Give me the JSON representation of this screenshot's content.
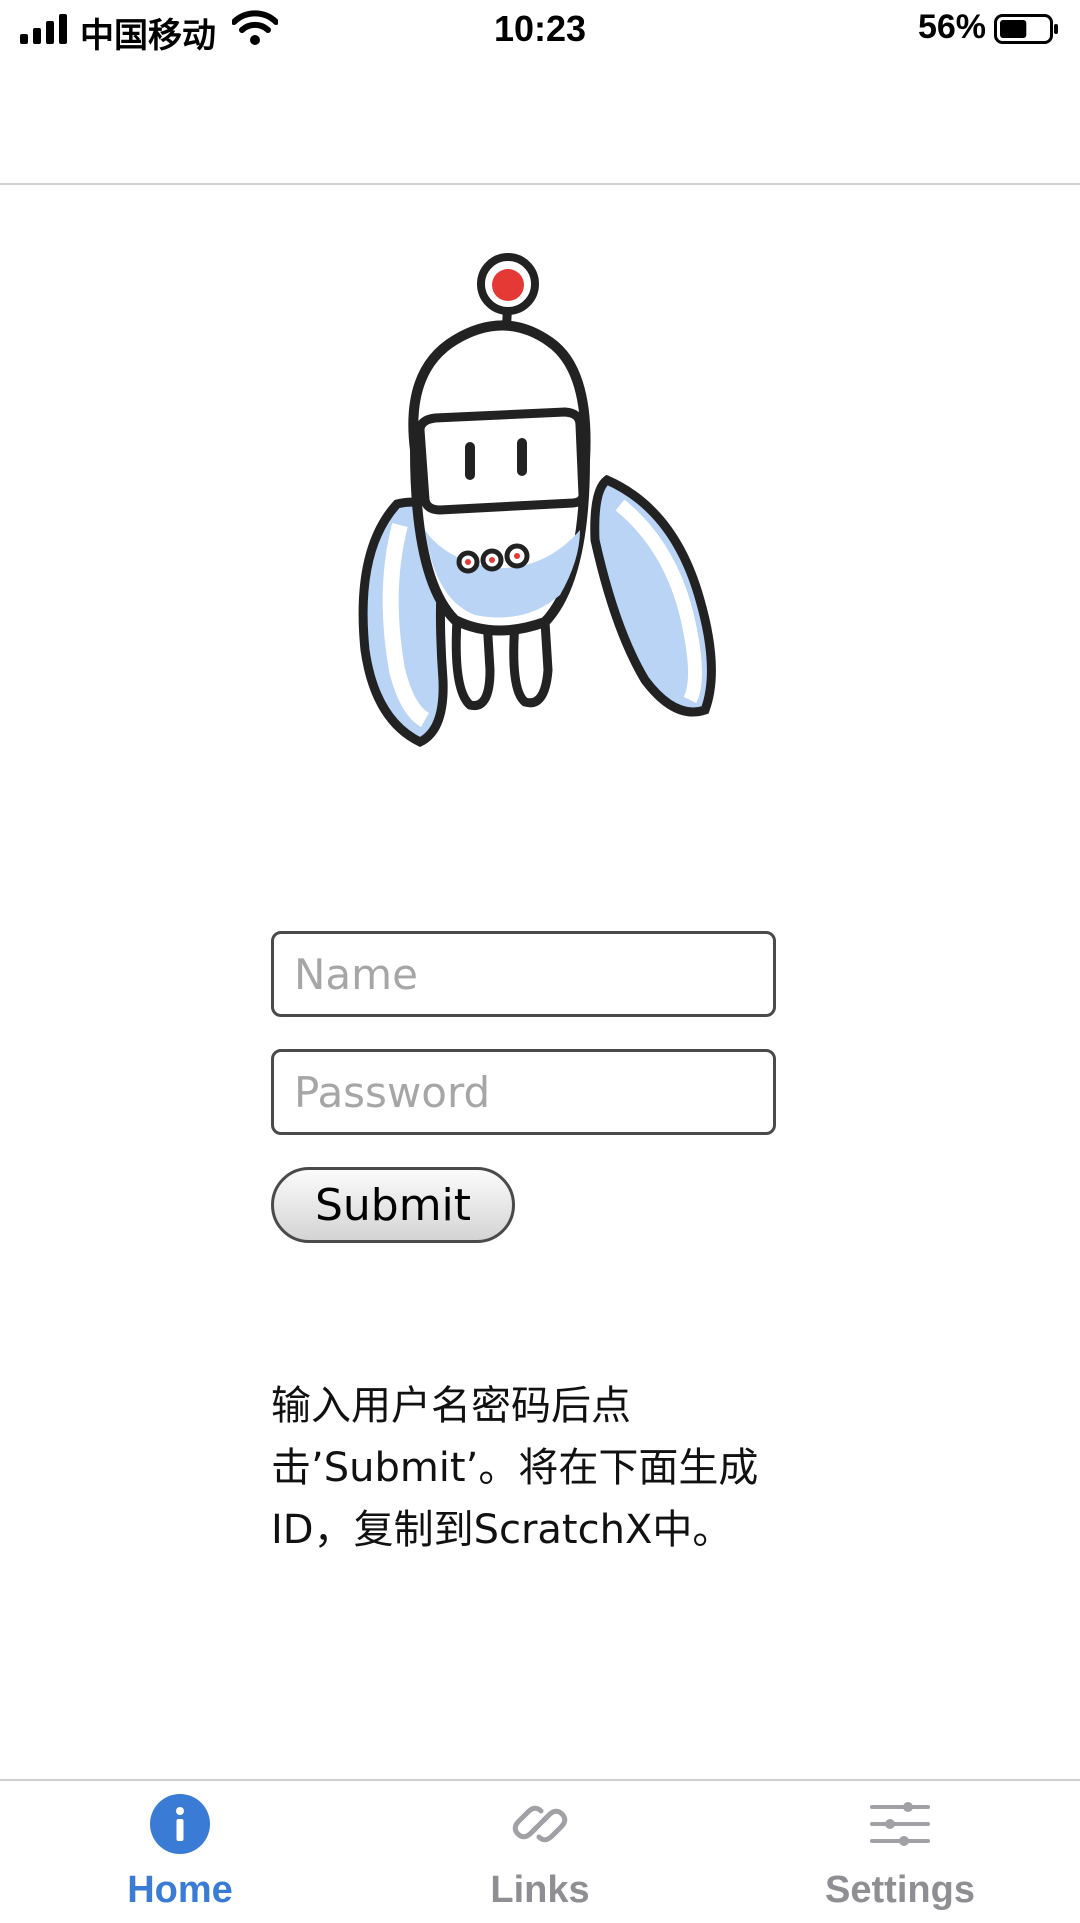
{
  "status_bar": {
    "carrier": "中国移动",
    "time": "10:23",
    "battery_percent": "56%",
    "battery_level": 0.56,
    "icons": [
      "signal-icon",
      "wifi-icon",
      "battery-icon"
    ]
  },
  "form": {
    "name_placeholder": "Name",
    "name_value": "",
    "password_placeholder": "Password",
    "password_value": "",
    "submit_label": "Submit"
  },
  "instructions": "输入用户名密码后点击’Submit’。将在下面生成ID，复制到ScratchX中。",
  "tabs": [
    {
      "label": "Home",
      "icon": "info-icon",
      "active": true
    },
    {
      "label": "Links",
      "icon": "link-icon",
      "active": false
    },
    {
      "label": "Settings",
      "icon": "sliders-icon",
      "active": false
    }
  ],
  "colors": {
    "accent": "#3a7bd5",
    "tab_inactive": "#8e8e93",
    "mascot_accent": "#b9d4f5",
    "antenna": "#e53935"
  }
}
